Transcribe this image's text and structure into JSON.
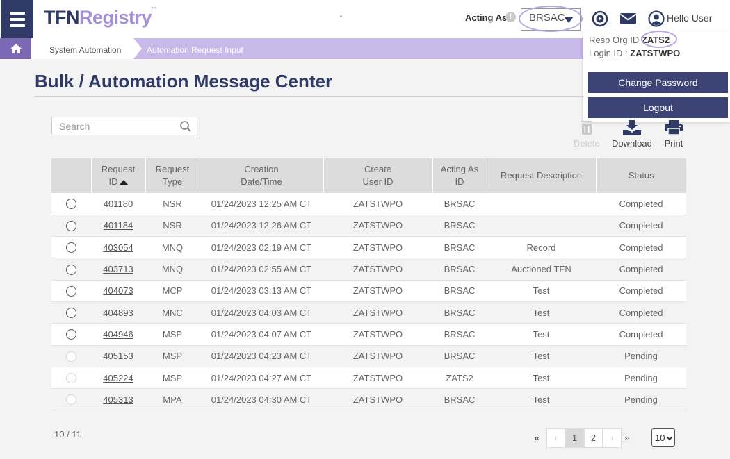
{
  "brand": {
    "part1": "TFN",
    "part2": "Registry",
    "tm": "™"
  },
  "header": {
    "acting_as_label": "Acting As",
    "acting_as_value": "BRSAC",
    "greeting": "Hello User",
    "info_symbol": "!",
    "icons": [
      "menu-icon",
      "info-icon",
      "play-circle-icon",
      "mail-icon",
      "user-circle-icon"
    ]
  },
  "breadcrumb": {
    "items": [
      "System Automation",
      "Automation Request Input"
    ],
    "home_icon": "home-icon"
  },
  "user_panel": {
    "resp_org_label": "Resp Org ID",
    "resp_org_value": "ZATS2",
    "login_label": "Login ID :",
    "login_value": "ZATSTWPO",
    "change_password": "Change Password",
    "logout": "Logout"
  },
  "page": {
    "title": "Bulk / Automation Message Center"
  },
  "search": {
    "placeholder": "Search"
  },
  "toolbar": {
    "delete": "Delete",
    "download": "Download",
    "print": "Print"
  },
  "table": {
    "headers": [
      {
        "l1": "",
        "l2": ""
      },
      {
        "l1": "Request",
        "l2": "ID"
      },
      {
        "l1": "Request",
        "l2": "Type"
      },
      {
        "l1": "Creation",
        "l2": "Date/Time"
      },
      {
        "l1": "Create",
        "l2": "User ID"
      },
      {
        "l1": "Acting As",
        "l2": "ID"
      },
      {
        "l1": "Request Description",
        "l2": ""
      },
      {
        "l1": "Status",
        "l2": ""
      }
    ],
    "rows": [
      {
        "id": "401180",
        "type": "NSR",
        "created": "01/24/2023 12:25 AM CT",
        "user": "ZATSTWPO",
        "acting": "BRSAC",
        "desc": "",
        "status": "Completed",
        "enabled": true
      },
      {
        "id": "401184",
        "type": "NSR",
        "created": "01/24/2023 12:26 AM CT",
        "user": "ZATSTWPO",
        "acting": "BRSAC",
        "desc": "",
        "status": "Completed",
        "enabled": true
      },
      {
        "id": "403054",
        "type": "MNQ",
        "created": "01/24/2023 02:19 AM CT",
        "user": "ZATSTWPO",
        "acting": "BRSAC",
        "desc": "Record",
        "status": "Completed",
        "enabled": true
      },
      {
        "id": "403713",
        "type": "MNQ",
        "created": "01/24/2023 02:55 AM CT",
        "user": "ZATSTWPO",
        "acting": "BRSAC",
        "desc": "Auctioned TFN",
        "status": "Completed",
        "enabled": true
      },
      {
        "id": "404073",
        "type": "MCP",
        "created": "01/24/2023 03:13 AM CT",
        "user": "ZATSTWPO",
        "acting": "BRSAC",
        "desc": "Test",
        "status": "Completed",
        "enabled": true
      },
      {
        "id": "404893",
        "type": "MNC",
        "created": "01/24/2023 04:03 AM CT",
        "user": "ZATSTWPO",
        "acting": "BRSAC",
        "desc": "Test",
        "status": "Completed",
        "enabled": true
      },
      {
        "id": "404946",
        "type": "MSP",
        "created": "01/24/2023 04:07 AM CT",
        "user": "ZATSTWPO",
        "acting": "BRSAC",
        "desc": "Test",
        "status": "Completed",
        "enabled": true
      },
      {
        "id": "405153",
        "type": "MSP",
        "created": "01/24/2023 04:23 AM CT",
        "user": "ZATSTWPO",
        "acting": "BRSAC",
        "desc": "Test",
        "status": "Pending",
        "enabled": false
      },
      {
        "id": "405224",
        "type": "MSP",
        "created": "01/24/2023 04:27 AM CT",
        "user": "ZATSTWPO",
        "acting": "ZATS2",
        "desc": "Test",
        "status": "Pending",
        "enabled": false
      },
      {
        "id": "405313",
        "type": "MPA",
        "created": "01/24/2023 04:30 AM CT",
        "user": "ZATSTWPO",
        "acting": "BRSAC",
        "desc": "Test",
        "status": "Pending",
        "enabled": false
      }
    ]
  },
  "pagination": {
    "count": "10 / 11",
    "first": "«",
    "prev": "‹",
    "pages": [
      "1",
      "2"
    ],
    "next": "›",
    "last": "»",
    "current_page": "1",
    "page_size": "10"
  },
  "colors": {
    "navy": "#2f3a66",
    "lavender": "#a48fd6",
    "breadcrumb_bg": "#c8b9e8",
    "home_bg": "#7d68b6",
    "button_bg": "#3b4475",
    "highlight": "#b9a4e3"
  }
}
